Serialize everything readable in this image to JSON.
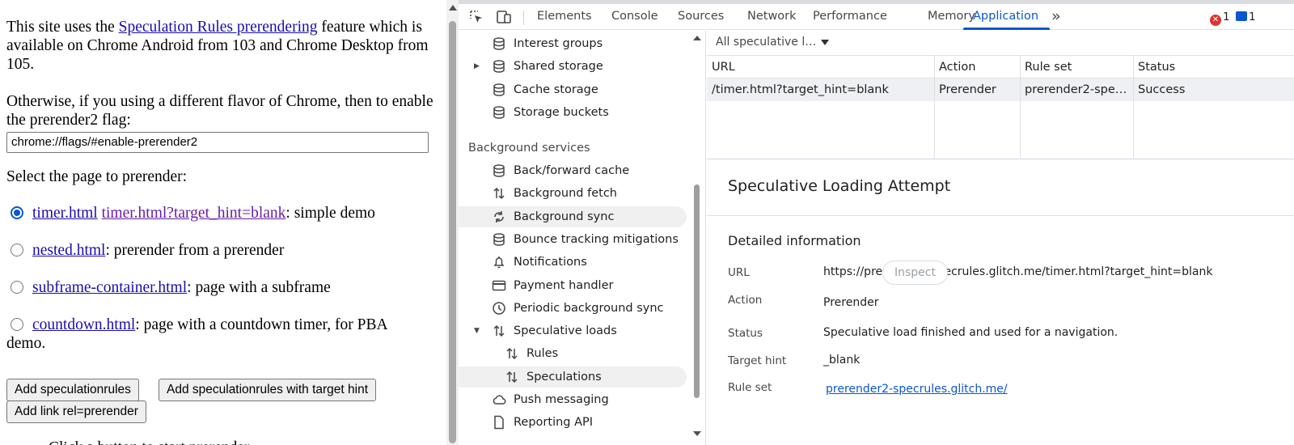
{
  "page": {
    "intro": {
      "before": "This site uses the ",
      "link": "Speculation Rules prerendering",
      "after": " feature which is available on Chrome Android from 103 and Chrome Desktop from 105."
    },
    "flag_text": "Otherwise, if you using a different flavor of Chrome, then to enable the prerender2 flag:",
    "flag_input_value": "chrome://flags/#enable-prerender2",
    "select_heading": "Select the page to prerender:",
    "options": [
      {
        "checked": true,
        "link1": "timer.html",
        "link2": "timer.html?target_hint=blank",
        "desc": ": simple demo"
      },
      {
        "checked": false,
        "link1": "nested.html",
        "desc": ": prerender from a prerender"
      },
      {
        "checked": false,
        "link1": "subframe-container.html",
        "desc": ": page with a subframe"
      },
      {
        "checked": false,
        "link1": "countdown.html",
        "desc": ": page with a countdown timer, for PBA demo."
      }
    ],
    "buttons": {
      "add_rules": "Add speculationrules",
      "add_rules_hint": "Add speculationrules with target hint",
      "add_link": "Add link rel=prerender"
    },
    "trailing_text": "Click a button to start prerender."
  },
  "devtools": {
    "tabs": [
      "Elements",
      "Console",
      "Sources",
      "Network",
      "Performance",
      "Memory",
      "Application"
    ],
    "active_tab": "Application",
    "more_tabs": "»",
    "error_count": "1",
    "message_count": "1",
    "colors": {
      "accent": "#0b57d0",
      "error": "#dc362e"
    },
    "sidebar": {
      "storage_items": [
        {
          "label": "Interest groups",
          "icon": "database-icon"
        },
        {
          "label": "Shared storage",
          "icon": "database-icon",
          "expandable": true
        },
        {
          "label": "Cache storage",
          "icon": "database-icon"
        },
        {
          "label": "Storage buckets",
          "icon": "database-icon"
        }
      ],
      "background_heading": "Background services",
      "background_items": [
        {
          "label": "Back/forward cache",
          "icon": "database-icon"
        },
        {
          "label": "Background fetch",
          "icon": "up-down-arrows-icon"
        },
        {
          "label": "Background sync",
          "icon": "sync-icon",
          "highlighted": true
        },
        {
          "label": "Bounce tracking mitigations",
          "icon": "database-icon"
        },
        {
          "label": "Notifications",
          "icon": "bell-icon"
        },
        {
          "label": "Payment handler",
          "icon": "card-icon"
        },
        {
          "label": "Periodic background sync",
          "icon": "clock-icon"
        },
        {
          "label": "Speculative loads",
          "icon": "up-down-arrows-icon",
          "expanded": true
        },
        {
          "label": "Rules",
          "icon": "up-down-arrows-icon",
          "child": true
        },
        {
          "label": "Speculations",
          "icon": "up-down-arrows-icon",
          "child": true,
          "selected": true
        },
        {
          "label": "Push messaging",
          "icon": "cloud-icon"
        },
        {
          "label": "Reporting API",
          "icon": "document-icon"
        }
      ]
    },
    "filter": {
      "label": "All speculative l…"
    },
    "grid": {
      "columns": [
        "URL",
        "Action",
        "Rule set",
        "Status"
      ],
      "rows": [
        [
          "/timer.html?target_hint=blank",
          "Prerender",
          "prerender2-spe…",
          "Success"
        ]
      ]
    },
    "detail": {
      "title": "Speculative Loading Attempt",
      "subtitle": "Detailed information",
      "fields": {
        "url_key": "URL",
        "url_val": "https://prerender2-specrules.glitch.me/timer.html?target_hint=blank",
        "action_key": "Action",
        "action_val": "Prerender",
        "inspect": "Inspect",
        "status_key": "Status",
        "status_val": "Speculative load finished and used for a navigation.",
        "hint_key": "Target hint",
        "hint_val": "_blank",
        "ruleset_key": "Rule set",
        "ruleset_val": "prerender2-specrules.glitch.me/"
      }
    }
  }
}
